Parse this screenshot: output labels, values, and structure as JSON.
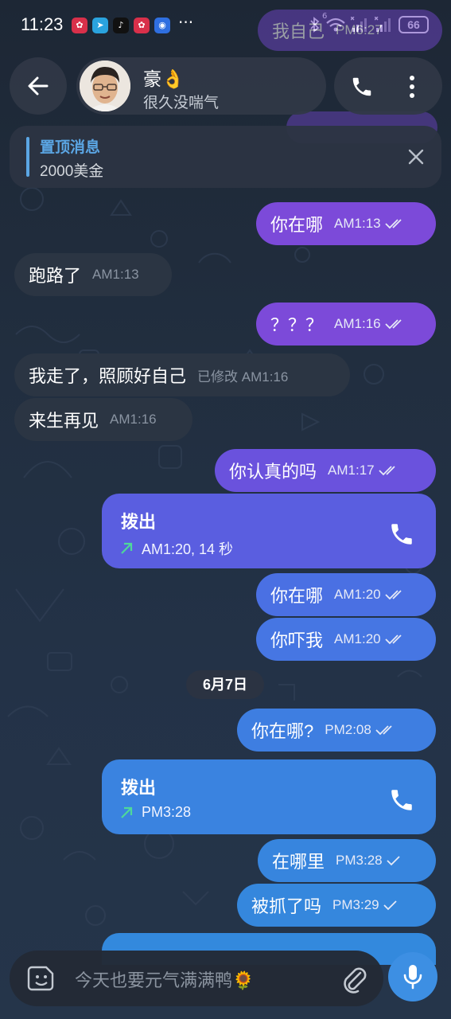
{
  "status_bar": {
    "time": "11:23",
    "more_dots": "···",
    "battery": "66",
    "network_sup": "6"
  },
  "header": {
    "contact_name": "豪👌",
    "contact_status": "很久没喘气"
  },
  "pinned": {
    "title": "置顶消息",
    "text": "2000美金"
  },
  "ghost_bubbles": [
    {
      "text": "我自己",
      "meta": "PM6:27"
    }
  ],
  "messages": {
    "m1": {
      "text": "你在哪",
      "meta": "AM1:13"
    },
    "m2": {
      "text": "跑路了",
      "meta": "AM1:13"
    },
    "m3": {
      "text": "？？？",
      "meta": "AM1:16"
    },
    "m4": {
      "text": "我走了，照顾好自己",
      "meta": "已修改 AM1:16"
    },
    "m5": {
      "text": "来生再见",
      "meta": "AM1:16"
    },
    "m6": {
      "text": "你认真的吗",
      "meta": "AM1:17"
    },
    "m8": {
      "text": "你在哪",
      "meta": "AM1:20"
    },
    "m9": {
      "text": "你吓我",
      "meta": "AM1:20"
    },
    "m10": {
      "text": "你在哪?",
      "meta": "PM2:08"
    },
    "m12": {
      "text": "在哪里",
      "meta": "PM3:28"
    },
    "m13": {
      "text": "被抓了吗",
      "meta": "PM3:29"
    }
  },
  "calls": {
    "c1": {
      "label": "拨出",
      "details": "AM1:20, 14 秒"
    },
    "c2": {
      "label": "拨出",
      "details": "PM3:28"
    }
  },
  "date_separator": "6月7日",
  "input": {
    "placeholder": "今天也要元气满满鸭🌻"
  },
  "colors": {
    "accent_blue": "#3d8fe3",
    "pinned_title": "#5ba6e4",
    "bubble_incoming": "#2b3543",
    "bubble_outgoing_purple": "#7c4ad9",
    "bubble_outgoing_blue": "#3a83e0",
    "call_arrow": "#4ed89a"
  }
}
